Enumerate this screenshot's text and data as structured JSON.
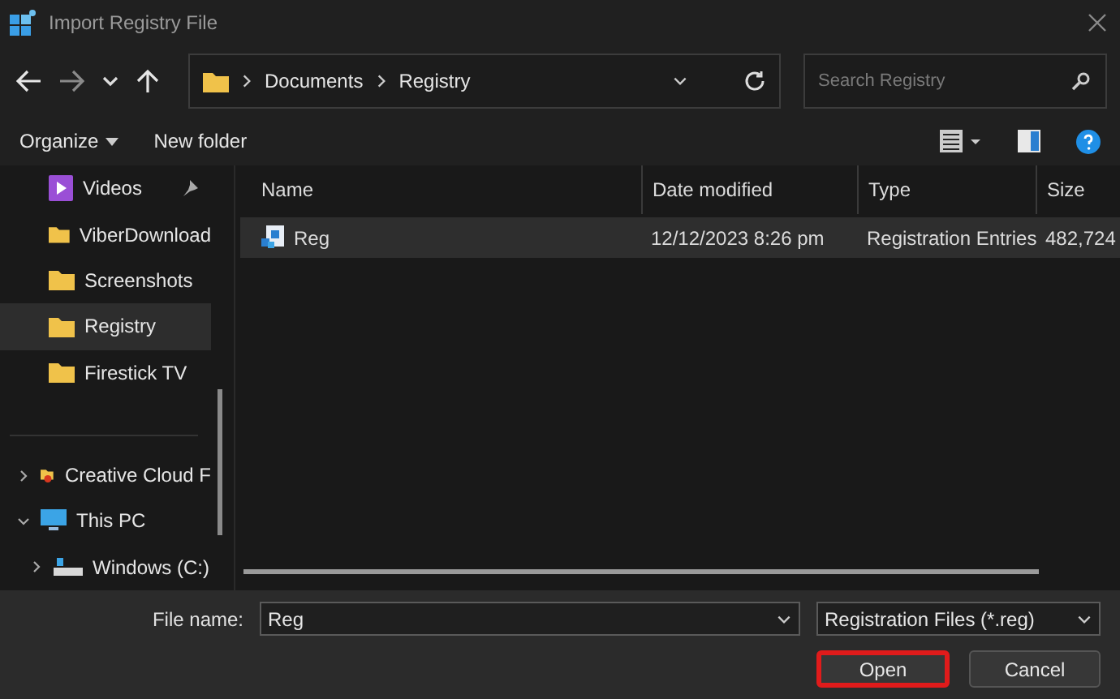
{
  "window": {
    "title": "Import Registry File"
  },
  "breadcrumb": [
    "Documents",
    "Registry"
  ],
  "search": {
    "placeholder": "Search Registry"
  },
  "toolbar": {
    "organize": "Organize",
    "new_folder": "New folder"
  },
  "sidebar": {
    "items": [
      {
        "label": "Videos",
        "kind": "video",
        "pinned": true,
        "selected": false
      },
      {
        "label": "ViberDownload",
        "kind": "folder",
        "pinned": false,
        "selected": false
      },
      {
        "label": "Screenshots",
        "kind": "folder",
        "pinned": false,
        "selected": false
      },
      {
        "label": "Registry",
        "kind": "folder",
        "pinned": false,
        "selected": true
      },
      {
        "label": "Firestick TV",
        "kind": "folder",
        "pinned": false,
        "selected": false
      }
    ],
    "tree": [
      {
        "label": "Creative Cloud F",
        "kind": "cloud",
        "expanded": false
      },
      {
        "label": "This PC",
        "kind": "pc",
        "expanded": true,
        "children": [
          {
            "label": "Windows (C:)",
            "kind": "drive",
            "expanded": false
          }
        ]
      }
    ]
  },
  "table": {
    "columns": [
      "Name",
      "Date modified",
      "Type",
      "Size"
    ],
    "rows": [
      {
        "cells": [
          "Reg",
          "12/12/2023 8:26 pm",
          "Registration Entries",
          "482,724"
        ],
        "selected": true
      }
    ]
  },
  "footer": {
    "file_name_label": "File name:",
    "file_name": "Reg",
    "filter": "Registration Files (*.reg)",
    "buttons": [
      {
        "label": "Open",
        "highlighted": true
      },
      {
        "label": "Cancel",
        "highlighted": false
      }
    ]
  }
}
